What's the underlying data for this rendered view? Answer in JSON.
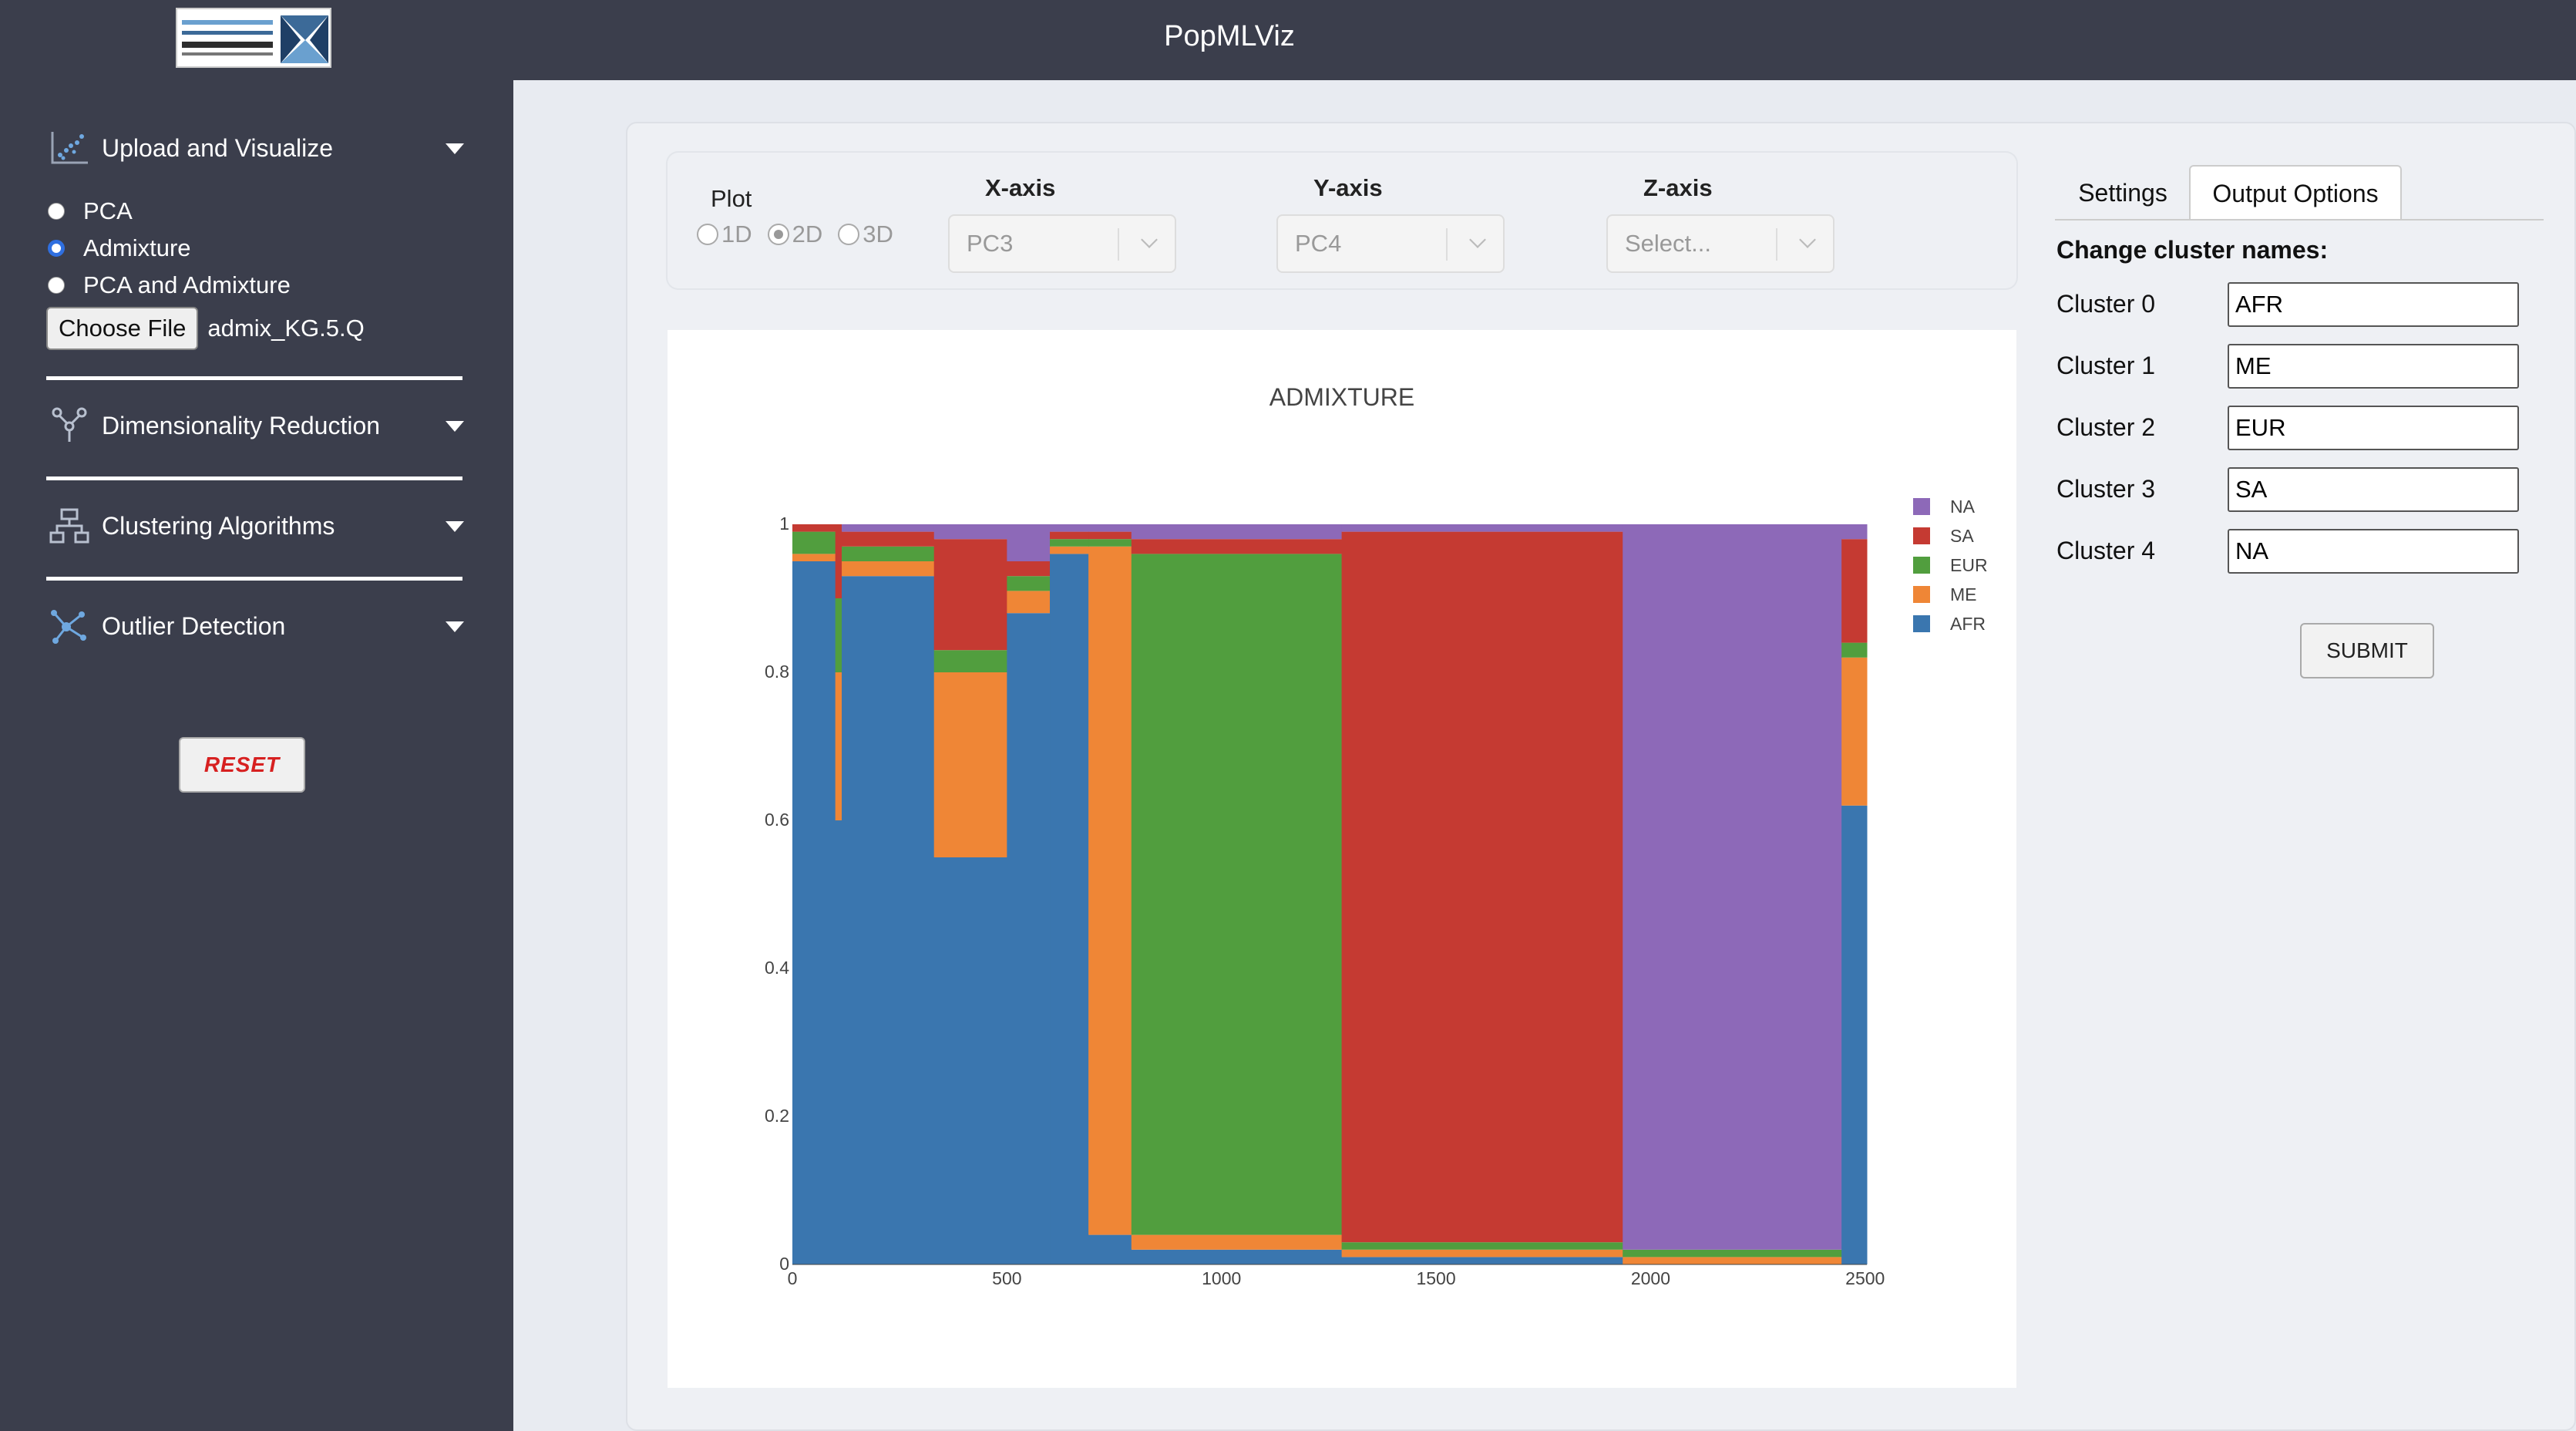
{
  "app": {
    "title": "PopMLViz"
  },
  "sidebar": {
    "upload": {
      "label": "Upload and Visualize"
    },
    "options": [
      {
        "label": "PCA",
        "checked": false
      },
      {
        "label": "Admixture",
        "checked": true
      },
      {
        "label": "PCA and Admixture",
        "checked": false
      }
    ],
    "choose_file_label": "Choose File",
    "file_name": "admix_KG.5.Q",
    "dimred": {
      "label": "Dimensionality Reduction"
    },
    "clustering": {
      "label": "Clustering Algorithms"
    },
    "outlier": {
      "label": "Outlier Detection"
    },
    "reset_label": "RESET"
  },
  "controls": {
    "plot_label": "Plot",
    "dims": [
      "1D",
      "2D",
      "3D"
    ],
    "selected_dim": "2D",
    "x_axis_label": "X-axis",
    "y_axis_label": "Y-axis",
    "z_axis_label": "Z-axis",
    "x_value": "PC3",
    "y_value": "PC4",
    "z_placeholder": "Select..."
  },
  "tabs": {
    "settings": "Settings",
    "output": "Output Options"
  },
  "cluster_panel": {
    "title": "Change cluster names:",
    "clusters": [
      {
        "label": "Cluster 0",
        "value": "AFR"
      },
      {
        "label": "Cluster 1",
        "value": "ME"
      },
      {
        "label": "Cluster 2",
        "value": "EUR"
      },
      {
        "label": "Cluster 3",
        "value": "SA"
      },
      {
        "label": "Cluster 4",
        "value": "NA"
      }
    ],
    "submit_label": "SUBMIT"
  },
  "chart_data": {
    "type": "bar",
    "stacked": true,
    "title": "ADMIXTURE",
    "xlabel": "",
    "ylabel": "",
    "xlim": [
      0,
      2504
    ],
    "ylim": [
      0,
      1
    ],
    "x_ticks": [
      0,
      500,
      1000,
      1500,
      2000,
      2500
    ],
    "y_ticks": [
      0,
      0.2,
      0.4,
      0.6,
      0.8,
      1
    ],
    "legend_position": "top-right",
    "legend": [
      "NA",
      "SA",
      "EUR",
      "ME",
      "AFR"
    ],
    "colors": {
      "AFR": "#3a76af",
      "ME": "#ef8636",
      "EUR": "#519e3e",
      "SA": "#c53a32",
      "NA": "#8d69b8"
    },
    "series_order": [
      "AFR",
      "ME",
      "EUR",
      "SA",
      "NA"
    ],
    "segments": [
      {
        "x0": 0,
        "x1": 100,
        "AFR": 0.95,
        "ME": 0.01,
        "EUR": 0.03,
        "SA": 0.01,
        "NA": 0.0
      },
      {
        "x0": 100,
        "x1": 115,
        "AFR": 0.6,
        "ME": 0.2,
        "EUR": 0.1,
        "SA": 0.1,
        "NA": 0.0
      },
      {
        "x0": 115,
        "x1": 330,
        "AFR": 0.93,
        "ME": 0.02,
        "EUR": 0.02,
        "SA": 0.02,
        "NA": 0.01
      },
      {
        "x0": 330,
        "x1": 500,
        "AFR": 0.55,
        "ME": 0.25,
        "EUR": 0.03,
        "SA": 0.15,
        "NA": 0.02
      },
      {
        "x0": 500,
        "x1": 600,
        "AFR": 0.88,
        "ME": 0.03,
        "EUR": 0.02,
        "SA": 0.02,
        "NA": 0.05
      },
      {
        "x0": 600,
        "x1": 690,
        "AFR": 0.96,
        "ME": 0.01,
        "EUR": 0.01,
        "SA": 0.01,
        "NA": 0.01
      },
      {
        "x0": 690,
        "x1": 790,
        "AFR": 0.04,
        "ME": 0.93,
        "EUR": 0.01,
        "SA": 0.01,
        "NA": 0.01
      },
      {
        "x0": 790,
        "x1": 1280,
        "AFR": 0.02,
        "ME": 0.02,
        "EUR": 0.92,
        "SA": 0.02,
        "NA": 0.02
      },
      {
        "x0": 1280,
        "x1": 1935,
        "AFR": 0.01,
        "ME": 0.01,
        "EUR": 0.01,
        "SA": 0.96,
        "NA": 0.01
      },
      {
        "x0": 1935,
        "x1": 2445,
        "AFR": 0.0,
        "ME": 0.01,
        "EUR": 0.01,
        "SA": 0.0,
        "NA": 0.98
      },
      {
        "x0": 2445,
        "x1": 2504,
        "AFR": 0.62,
        "ME": 0.2,
        "EUR": 0.02,
        "SA": 0.14,
        "NA": 0.02
      }
    ]
  }
}
